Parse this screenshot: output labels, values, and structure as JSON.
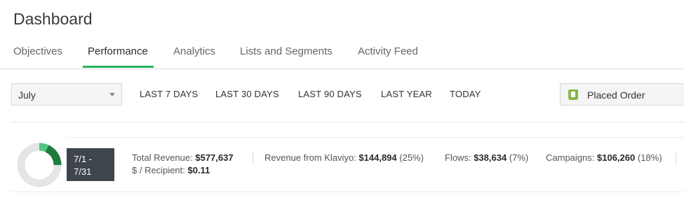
{
  "header": {
    "title": "Dashboard"
  },
  "tabs": [
    {
      "label": "Objectives"
    },
    {
      "label": "Performance"
    },
    {
      "label": "Analytics"
    },
    {
      "label": "Lists and Segments"
    },
    {
      "label": "Activity Feed"
    }
  ],
  "toolbar": {
    "month_select": "July",
    "ranges": [
      "LAST 7 DAYS",
      "LAST 30 DAYS",
      "LAST 90 DAYS",
      "LAST YEAR",
      "TODAY"
    ],
    "metric_select": "Placed Order"
  },
  "summary": {
    "date_range_line1": "7/1 -",
    "date_range_line2": "7/31",
    "total_revenue_label": "Total Revenue:",
    "total_revenue_value": "$577,637",
    "per_recipient_label": "$ / Recipient:",
    "per_recipient_value": "$0.11",
    "klaviyo_label": "Revenue from Klaviyo:",
    "klaviyo_value": "$144,894",
    "klaviyo_pct": "(25%)",
    "flows_label": "Flows:",
    "flows_value": "$38,634",
    "flows_pct": "(7%)",
    "campaigns_label": "Campaigns:",
    "campaigns_value": "$106,260",
    "campaigns_pct": "(18%)",
    "donut": {
      "flows_share": 0.07,
      "campaigns_share": 0.18,
      "flows_color": "#4fc87d",
      "campaigns_color": "#1f7a3e",
      "track_color": "#e3e5e7"
    }
  },
  "colors": {
    "accent": "#28b35e"
  }
}
